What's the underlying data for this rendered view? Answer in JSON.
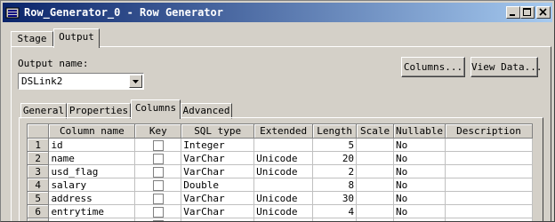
{
  "window": {
    "title": "Row_Generator_0 - Row Generator"
  },
  "main_tabs": [
    {
      "label": "Stage",
      "selected": false
    },
    {
      "label": "Output",
      "selected": true
    }
  ],
  "output": {
    "name_label": "Output name:",
    "name_value": "DSLink2",
    "columns_button": "Columns...",
    "view_data_button": "View Data..."
  },
  "sub_tabs": [
    {
      "label": "General",
      "selected": false
    },
    {
      "label": "Properties",
      "selected": false
    },
    {
      "label": "Columns",
      "selected": true
    },
    {
      "label": "Advanced",
      "selected": false
    }
  ],
  "grid": {
    "headers": [
      "Column name",
      "Key",
      "SQL type",
      "Extended",
      "Length",
      "Scale",
      "Nullable",
      "Description"
    ],
    "rows": [
      {
        "num": "1",
        "name": "id",
        "key": false,
        "sql_type": "Integer",
        "extended": "",
        "length": "5",
        "scale": "",
        "nullable": "No",
        "description": ""
      },
      {
        "num": "2",
        "name": "name",
        "key": false,
        "sql_type": "VarChar",
        "extended": "Unicode",
        "length": "20",
        "scale": "",
        "nullable": "No",
        "description": ""
      },
      {
        "num": "3",
        "name": "usd_flag",
        "key": false,
        "sql_type": "VarChar",
        "extended": "Unicode",
        "length": "2",
        "scale": "",
        "nullable": "No",
        "description": ""
      },
      {
        "num": "4",
        "name": "salary",
        "key": false,
        "sql_type": "Double",
        "extended": "",
        "length": "8",
        "scale": "",
        "nullable": "No",
        "description": ""
      },
      {
        "num": "5",
        "name": "address",
        "key": false,
        "sql_type": "VarChar",
        "extended": "Unicode",
        "length": "30",
        "scale": "",
        "nullable": "No",
        "description": ""
      },
      {
        "num": "6",
        "name": "entrytime",
        "key": false,
        "sql_type": "VarChar",
        "extended": "Unicode",
        "length": "4",
        "scale": "",
        "nullable": "No",
        "description": ""
      }
    ]
  },
  "colors": {
    "title_start": "#0a246a",
    "title_end": "#a6caf0",
    "face": "#d4d0c8"
  }
}
